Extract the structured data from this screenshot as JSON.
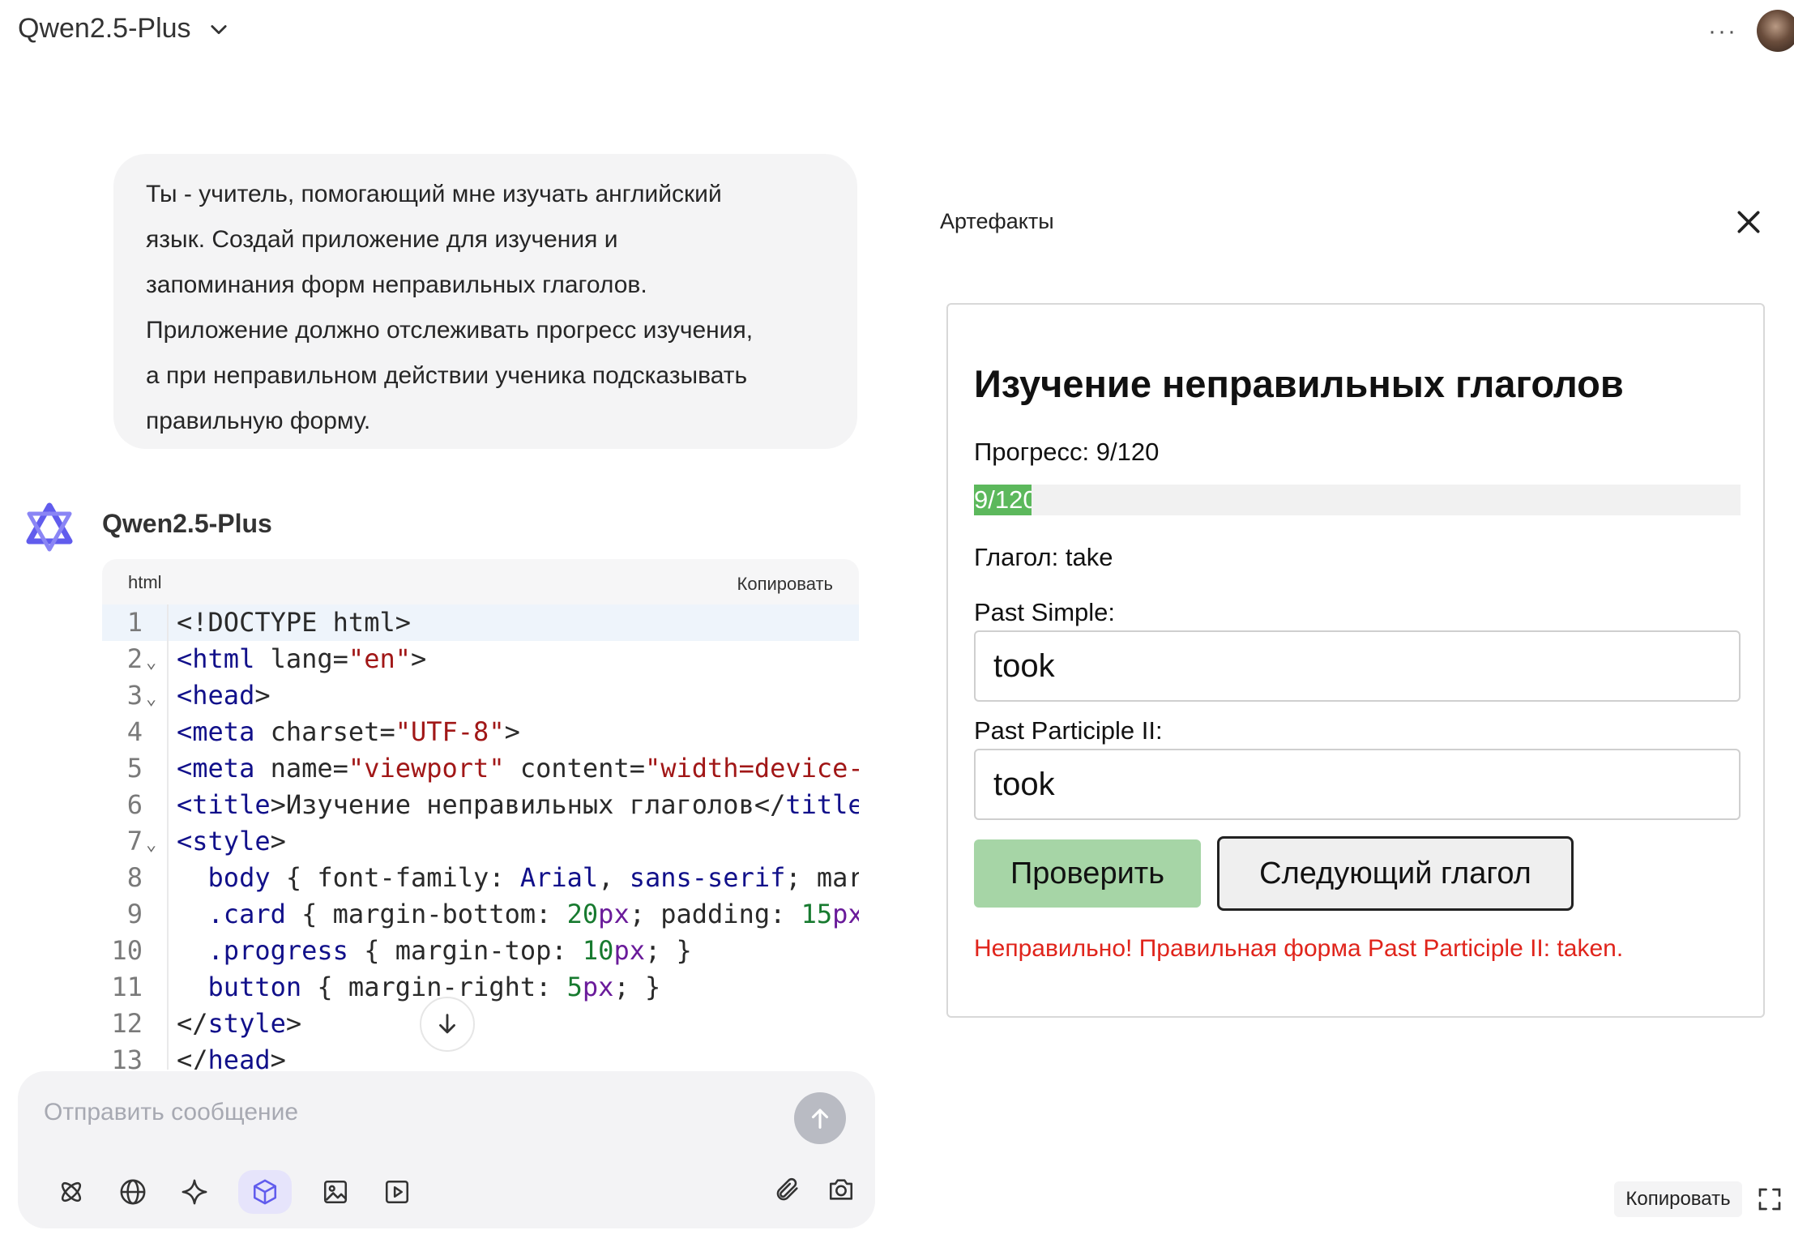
{
  "header": {
    "model_name": "Qwen2.5-Plus"
  },
  "user_message": {
    "lines": [
      "Ты - учитель, помогающий мне изучать английский",
      "язык. Создай приложение для изучения и",
      "запоминания форм неправильных глаголов.",
      "Приложение должно отслеживать прогресс изучения,",
      "а при неправильном действии ученика подсказывать",
      "правильную форму."
    ]
  },
  "assistant": {
    "name": "Qwen2.5-Plus",
    "code": {
      "language": "html",
      "copy_label": "Копировать",
      "lines": [
        {
          "n": "1",
          "fold": "",
          "html": "&lt;!DOCTYPE html&gt;"
        },
        {
          "n": "2",
          "fold": "⌄",
          "html": "<span class='k-tag'>&lt;html</span> lang=<span class='k-str'>\"en\"</span>&gt;"
        },
        {
          "n": "3",
          "fold": "⌄",
          "html": "<span class='k-tag'>&lt;head</span>&gt;"
        },
        {
          "n": "4",
          "fold": "",
          "html": "<span class='k-tag'>&lt;meta</span> charset=<span class='k-str'>\"UTF-8\"</span>&gt;"
        },
        {
          "n": "5",
          "fold": "",
          "html": "<span class='k-tag'>&lt;meta</span> name=<span class='k-str'>\"viewport\"</span> content=<span class='k-str'>\"width=device-</span>"
        },
        {
          "n": "6",
          "fold": "",
          "html": "<span class='k-tag'>&lt;title</span>&gt;Изучение неправильных глаголов&lt;/<span class='k-tag'>title</span>"
        },
        {
          "n": "7",
          "fold": "⌄",
          "html": "<span class='k-tag'>&lt;style</span>&gt;"
        },
        {
          "n": "8",
          "fold": "",
          "html": "  <span class='k-tag'>body</span> { font-family: <span class='k-tag'>Arial</span>, <span class='k-tag'>sans-serif</span>; mar"
        },
        {
          "n": "9",
          "fold": "",
          "html": "  <span class='k-tag'>.card</span> { margin-bottom: <span class='k-num'>20</span><span class='k-unit'>px</span>; padding: <span class='k-num'>15</span><span class='k-unit'>px</span>"
        },
        {
          "n": "10",
          "fold": "",
          "html": "  <span class='k-tag'>.progress</span> { margin-top: <span class='k-num'>10</span><span class='k-unit'>px</span>; }"
        },
        {
          "n": "11",
          "fold": "",
          "html": "  <span class='k-tag'>button</span> { margin-right: <span class='k-num'>5</span><span class='k-unit'>px</span>; }"
        },
        {
          "n": "12",
          "fold": "",
          "html": "&lt;/<span class='k-tag'>style</span>&gt;"
        },
        {
          "n": "13",
          "fold": "",
          "html": "&lt;/<span class='k-tag'>head</span>&gt;"
        }
      ]
    }
  },
  "composer": {
    "placeholder": "Отправить сообщение",
    "tools": [
      "atom-icon",
      "globe-icon",
      "sparkle-icon",
      "cube-icon",
      "image-icon",
      "video-icon"
    ],
    "right_tools": [
      "paperclip-icon",
      "camera-icon"
    ]
  },
  "artifacts": {
    "title": "Артефакты",
    "app": {
      "heading": "Изучение неправильных глаголов",
      "progress_label": "Прогресс: 9/120",
      "progress_bar_text": "9/120",
      "progress_fraction": 0.075,
      "verb_label": "Глагол: take",
      "past_simple_label": "Past Simple:",
      "past_simple_value": "took",
      "past_participle_label": "Past Participle II:",
      "past_participle_value": "took",
      "check_button": "Проверить",
      "next_button": "Следующий глагол",
      "feedback": "Неправильно! Правильная форма Past Participle II: taken."
    },
    "copy_label": "Копировать"
  },
  "colors": {
    "progress": "#5cb85c",
    "check_button": "#a6d5a6",
    "error": "#e0241b",
    "accent": "#615ced"
  }
}
